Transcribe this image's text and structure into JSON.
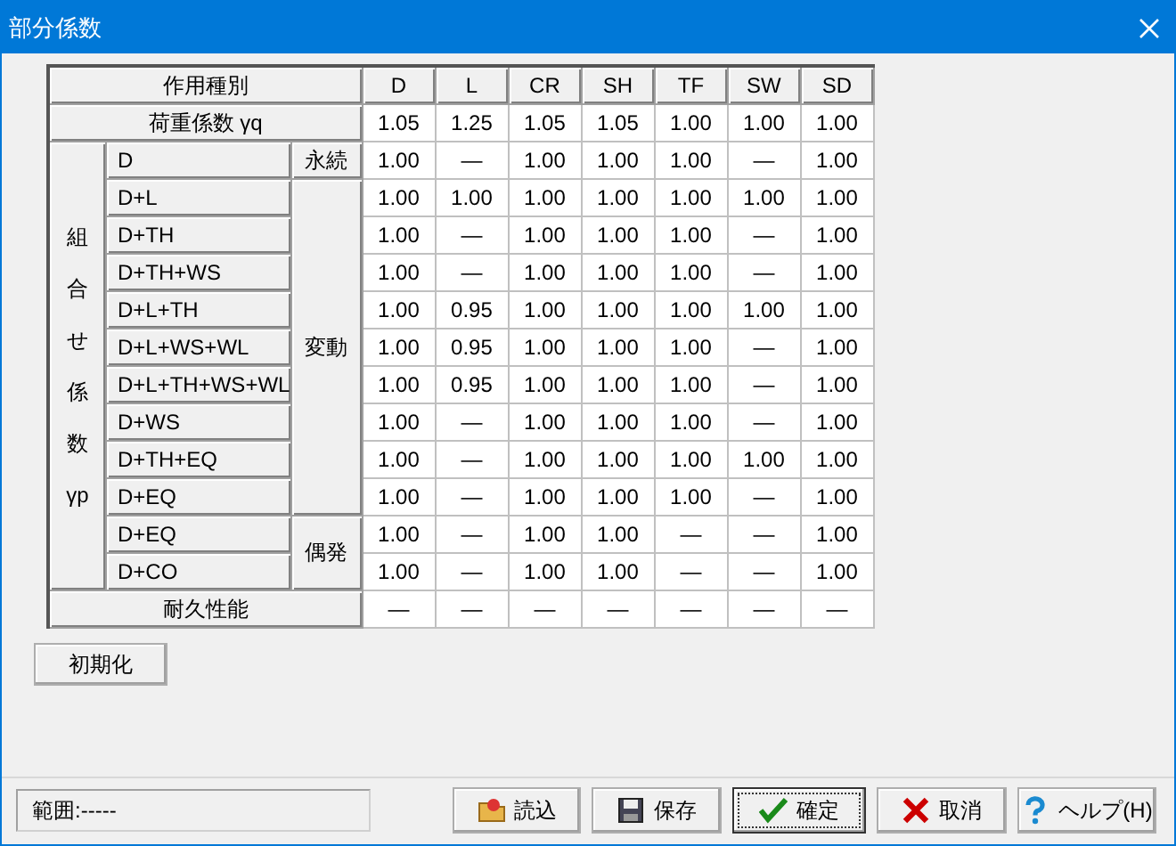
{
  "window": {
    "title": "部分係数"
  },
  "table": {
    "header_label": "作用種別",
    "columns": [
      "D",
      "L",
      "CR",
      "SH",
      "TF",
      "SW",
      "SD"
    ],
    "load_factor": {
      "label": "荷重係数 γq",
      "values": [
        "1.05",
        "1.25",
        "1.05",
        "1.05",
        "1.00",
        "1.00",
        "1.00"
      ]
    },
    "group_label": [
      "組",
      "合",
      "せ",
      "係",
      "数",
      "γp"
    ],
    "categories": [
      {
        "label": "永続",
        "rows": [
          {
            "name": "D",
            "values": [
              "1.00",
              "—",
              "1.00",
              "1.00",
              "1.00",
              "—",
              "1.00"
            ]
          }
        ]
      },
      {
        "label": "変動",
        "rows": [
          {
            "name": "D+L",
            "values": [
              "1.00",
              "1.00",
              "1.00",
              "1.00",
              "1.00",
              "1.00",
              "1.00"
            ]
          },
          {
            "name": "D+TH",
            "values": [
              "1.00",
              "—",
              "1.00",
              "1.00",
              "1.00",
              "—",
              "1.00"
            ]
          },
          {
            "name": "D+TH+WS",
            "values": [
              "1.00",
              "—",
              "1.00",
              "1.00",
              "1.00",
              "—",
              "1.00"
            ]
          },
          {
            "name": "D+L+TH",
            "values": [
              "1.00",
              "0.95",
              "1.00",
              "1.00",
              "1.00",
              "1.00",
              "1.00"
            ]
          },
          {
            "name": "D+L+WS+WL",
            "values": [
              "1.00",
              "0.95",
              "1.00",
              "1.00",
              "1.00",
              "—",
              "1.00"
            ]
          },
          {
            "name": "D+L+TH+WS+WL",
            "values": [
              "1.00",
              "0.95",
              "1.00",
              "1.00",
              "1.00",
              "—",
              "1.00"
            ]
          },
          {
            "name": "D+WS",
            "values": [
              "1.00",
              "—",
              "1.00",
              "1.00",
              "1.00",
              "—",
              "1.00"
            ]
          },
          {
            "name": "D+TH+EQ",
            "values": [
              "1.00",
              "—",
              "1.00",
              "1.00",
              "1.00",
              "1.00",
              "1.00"
            ]
          },
          {
            "name": "D+EQ",
            "values": [
              "1.00",
              "—",
              "1.00",
              "1.00",
              "1.00",
              "—",
              "1.00"
            ]
          }
        ]
      },
      {
        "label": "偶発",
        "rows": [
          {
            "name": "D+EQ",
            "values": [
              "1.00",
              "—",
              "1.00",
              "1.00",
              "—",
              "—",
              "1.00"
            ]
          },
          {
            "name": "D+CO",
            "values": [
              "1.00",
              "—",
              "1.00",
              "1.00",
              "—",
              "—",
              "1.00"
            ]
          }
        ]
      }
    ],
    "durability": {
      "label": "耐久性能",
      "values": [
        "—",
        "—",
        "—",
        "—",
        "—",
        "—",
        "—"
      ]
    }
  },
  "init_button": "初期化",
  "status": "範囲:-----",
  "buttons": [
    {
      "kind": "load",
      "label": "読込",
      "default": false
    },
    {
      "kind": "save",
      "label": "保存",
      "default": false
    },
    {
      "kind": "confirm",
      "label": "確定",
      "default": true
    },
    {
      "kind": "cancel",
      "label": "取消",
      "default": false
    },
    {
      "kind": "help",
      "label": "ヘルプ(H)",
      "default": false
    }
  ]
}
